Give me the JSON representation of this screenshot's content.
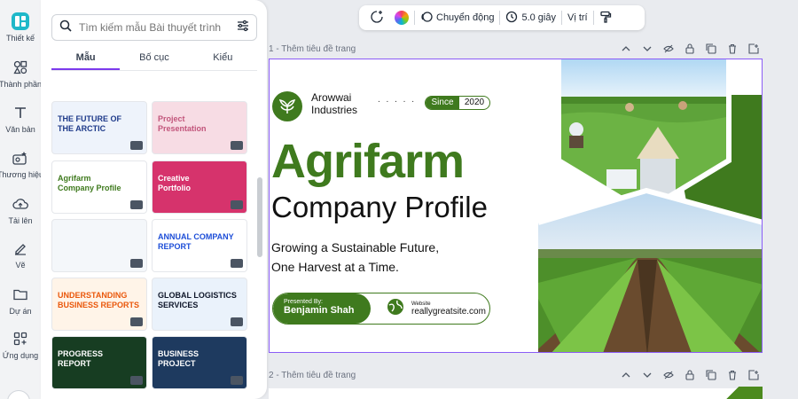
{
  "rail": {
    "items": [
      {
        "label": "Thiết kế",
        "icon": "layout-icon"
      },
      {
        "label": "Thành phần",
        "icon": "shapes-icon"
      },
      {
        "label": "Văn bản",
        "icon": "text-icon"
      },
      {
        "label": "Thương hiệu",
        "icon": "brand-icon"
      },
      {
        "label": "Tải lên",
        "icon": "upload-cloud-icon"
      },
      {
        "label": "Vẽ",
        "icon": "pen-icon"
      },
      {
        "label": "Dự án",
        "icon": "folder-icon"
      },
      {
        "label": "Ứng dụng",
        "icon": "apps-icon"
      }
    ]
  },
  "panel": {
    "search_placeholder": "Tìm kiếm mẫu Bài thuyết trình",
    "tabs": [
      "Mẫu",
      "Bố cục",
      "Kiểu"
    ],
    "templates": [
      {
        "line1": "THE FUTURE OF",
        "line2": "THE ARCTIC",
        "bg": "#eef3fb",
        "fg": "#1e3a8a"
      },
      {
        "line1": "Project",
        "line2": "Presentation",
        "bg": "#f7dce4",
        "fg": "#c2557b"
      },
      {
        "line1": "Agrifarm",
        "line2": "Company Profile",
        "bg": "#ffffff",
        "fg": "#3f7a1e"
      },
      {
        "line1": "Creative",
        "line2": "Portfolio",
        "bg": "#d6336c",
        "fg": "#ffffff"
      },
      {
        "line1": "",
        "line2": "",
        "bg": "#f4f7fa",
        "fg": "#2563eb"
      },
      {
        "line1": "ANNUAL COMPANY",
        "line2": "REPORT",
        "bg": "#ffffff",
        "fg": "#1d4ed8"
      },
      {
        "line1": "UNDERSTANDING",
        "line2": "BUSINESS REPORTS",
        "bg": "#fff4e8",
        "fg": "#ea580c"
      },
      {
        "line1": "GLOBAL LOGISTICS",
        "line2": "SERVICES",
        "bg": "#eaf2fb",
        "fg": "#0f172a"
      },
      {
        "line1": "PROGRESS",
        "line2": "REPORT",
        "bg": "#173d22",
        "fg": "#ffffff"
      },
      {
        "line1": "BUSINESS",
        "line2": "PROJECT",
        "bg": "#1e3a5f",
        "fg": "#ffffff"
      }
    ]
  },
  "toolbar": {
    "animate_label": "Chuyển động",
    "duration_label": "5.0 giây",
    "position_label": "Vị trí"
  },
  "pages": {
    "page1_label": "1 - Thêm tiêu đề trang",
    "page2_label": "2 - Thêm tiêu đề trang"
  },
  "slide": {
    "brand_line1": "Arowwai",
    "brand_line2": "Industries",
    "dots": ". . . . .",
    "since_label": "Since",
    "since_year": "2020",
    "title": "Agrifarm",
    "subtitle": "Company Profile",
    "tagline1": "Growing a Sustainable Future,",
    "tagline2": "One Harvest at a Time.",
    "presented_by": "Presented By:",
    "presenter": "Benjamin Shah",
    "website_label": "Website",
    "website": "reallygreatsite.com",
    "accent": "#3f7a1e"
  }
}
